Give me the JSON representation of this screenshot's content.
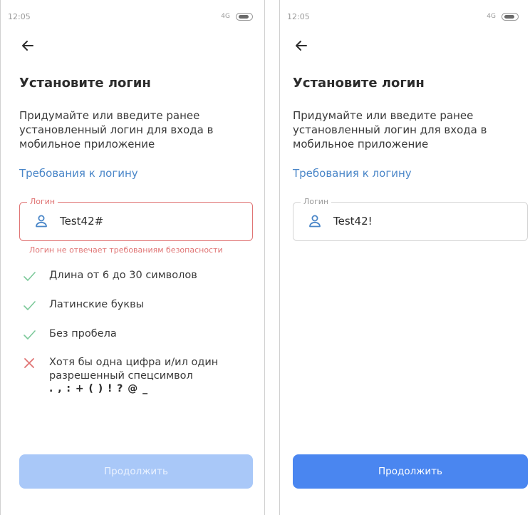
{
  "colors": {
    "accent": "#4a86f0",
    "link": "#4a86c8",
    "error": "#e07474",
    "ok": "#7cc99a",
    "disabled": "#a9c8f8"
  },
  "left": {
    "status": {
      "time": "12:05",
      "signal": "4G"
    },
    "title": "Установите логин",
    "description": "Придумайте или введите ранее установленный логин для входа в мобильное приложение",
    "requirements_link": "Требования к логину",
    "field": {
      "label": "Логин",
      "value": "Test42#",
      "icon": "user-icon"
    },
    "error_text": "Логин не отвечает требованиям безопасности",
    "rules": [
      {
        "text": "Длина от 6 до 30 символов",
        "status": "ok"
      },
      {
        "text": "Латинские буквы",
        "status": "ok"
      },
      {
        "text": "Без пробела",
        "status": "ok"
      },
      {
        "text": "Хотя бы одна цифра и/ил один разрешенный спецсимвол",
        "symbols": ". , : + ( ) ! ? @ _",
        "status": "fail"
      }
    ],
    "button": {
      "label": "Продолжить",
      "state": "disabled"
    }
  },
  "right": {
    "status": {
      "time": "12:05",
      "signal": "4G"
    },
    "title": "Установите логин",
    "description": "Придумайте или введите ранее установленный логин для входа в мобильное приложение",
    "requirements_link": "Требования к логину",
    "field": {
      "label": "Логин",
      "value": "Test42!",
      "icon": "user-icon"
    },
    "button": {
      "label": "Продолжить",
      "state": "active"
    }
  }
}
